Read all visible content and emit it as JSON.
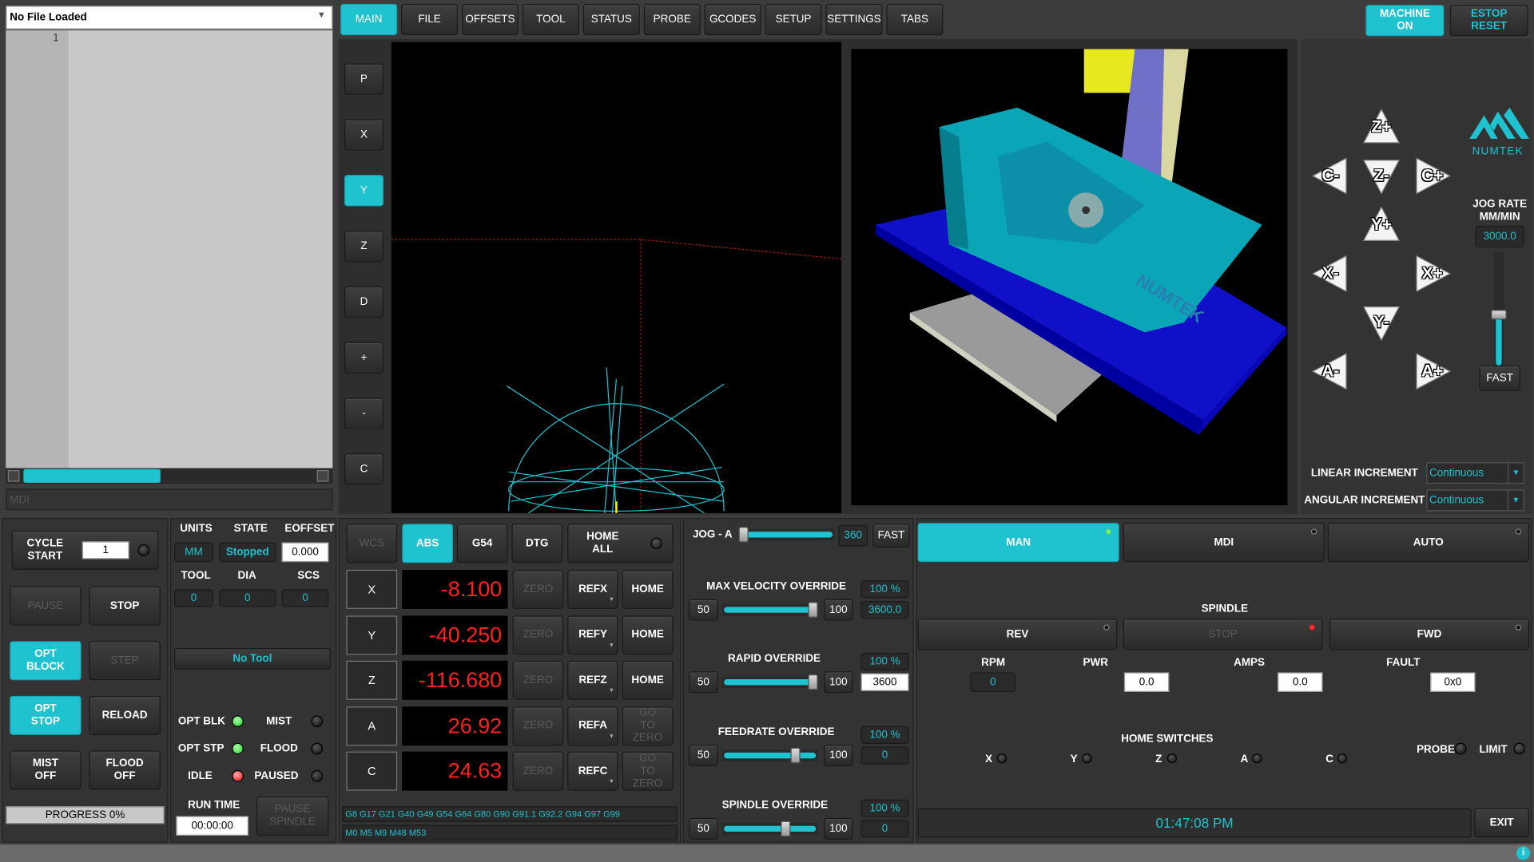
{
  "file": {
    "selector": "No File Loaded",
    "line_number": "1",
    "mdi_placeholder": "MDI"
  },
  "tabs": [
    "MAIN",
    "FILE",
    "OFFSETS",
    "TOOL",
    "STATUS",
    "PROBE",
    "GCODES",
    "SETUP",
    "SETTINGS",
    "TABS"
  ],
  "header": {
    "machine_on": "MACHINE ON",
    "estop_reset": "ESTOP RESET"
  },
  "view_buttons": [
    "P",
    "X",
    "Y",
    "Z",
    "D",
    "+",
    "-",
    "C"
  ],
  "jog": {
    "buttons": [
      "Z+",
      "C-",
      "Z-",
      "C+",
      "Y+",
      "X-",
      "X+",
      "Y-",
      "A-",
      "A+"
    ],
    "rate_label": "JOG RATE MM/MIN",
    "rate_value": "3000.0",
    "fast": "FAST",
    "linear_increment_label": "LINEAR INCREMENT",
    "linear_increment_value": "Continuous",
    "angular_increment_label": "ANGULAR INCREMENT",
    "angular_increment_value": "Continuous",
    "logo": "NUMTEK",
    "rate_fraction": 0.45
  },
  "cycle": {
    "cycle_start": "CYCLE START",
    "start_line": "1",
    "pause": "PAUSE",
    "stop": "STOP",
    "opt_block": "OPT BLOCK",
    "step": "STEP",
    "opt_stop": "OPT STOP",
    "reload": "RELOAD",
    "mist_off": "MIST OFF",
    "flood_off": "FLOOD OFF",
    "progress": "PROGRESS 0%"
  },
  "status": {
    "units_label": "UNITS",
    "state_label": "STATE",
    "eoffset_label": "EOFFSET",
    "units": "MM",
    "state": "Stopped",
    "eoffset": "0.000",
    "tool_label": "TOOL",
    "dia_label": "DIA",
    "scs_label": "SCS",
    "tool": "0",
    "dia": "0",
    "scs": "0",
    "tool_name": "No Tool",
    "opt_blk": "OPT BLK",
    "mist": "MIST",
    "opt_stp": "OPT STP",
    "flood": "FLOOD",
    "idle": "IDLE",
    "paused": "PAUSED",
    "run_time_label": "RUN TIME",
    "run_time": "00:00:00",
    "pause_spindle": "PAUSE SPINDLE"
  },
  "dro": {
    "wcs": "WCS",
    "abs": "ABS",
    "g54": "G54",
    "dtg": "DTG",
    "home_all": "HOME ALL",
    "axes": [
      {
        "name": "X",
        "value": "-8.100",
        "ref": "REFX",
        "act": "HOME"
      },
      {
        "name": "Y",
        "value": "-40.250",
        "ref": "REFY",
        "act": "HOME"
      },
      {
        "name": "Z",
        "value": "-116.680",
        "ref": "REFZ",
        "act": "HOME"
      },
      {
        "name": "A",
        "value": "26.92",
        "ref": "REFA",
        "act": "GO TO ZERO"
      },
      {
        "name": "C",
        "value": "24.63",
        "ref": "REFC",
        "act": "GO TO ZERO"
      }
    ],
    "zero": "ZERO",
    "gcodes": "G8 G17 G21 G40 G49 G54 G64 G80 G90 G91.1 G92.2 G94 G97 G99",
    "mcodes": "M0 M5 M9 M48 M53"
  },
  "overrides": {
    "jog_a_label": "JOG - A",
    "jog_a_value": "360",
    "fast": "FAST",
    "items": [
      {
        "label": "MAX VELOCITY OVERRIDE",
        "min": "50",
        "max": "100",
        "pct": "100 %",
        "val": "3600.0",
        "pos": 1.0
      },
      {
        "label": "RAPID OVERRIDE",
        "min": "50",
        "max": "100",
        "pct": "100 %",
        "val": "3600",
        "pos": 1.0
      },
      {
        "label": "FEEDRATE OVERRIDE",
        "min": "50",
        "max": "100",
        "pct": "100 %",
        "val": "0",
        "pos": 0.8
      },
      {
        "label": "SPINDLE OVERRIDE",
        "min": "50",
        "max": "100",
        "pct": "100 %",
        "val": "0",
        "pos": 0.68
      }
    ]
  },
  "mode": {
    "man": "MAN",
    "mdi": "MDI",
    "auto": "AUTO"
  },
  "spindle": {
    "label": "SPINDLE",
    "rev": "REV",
    "stop": "STOP",
    "fwd": "FWD",
    "rpm_label": "RPM",
    "pwr_label": "PWR",
    "amps_label": "AMPS",
    "fault_label": "FAULT",
    "rpm": "0",
    "pwr": "0.0",
    "amps": "0.0",
    "fault": "0x0"
  },
  "home_switches": {
    "label": "HOME SWITCHES",
    "axes": [
      "X",
      "Y",
      "Z",
      "A",
      "C"
    ],
    "probe": "PROBE",
    "limit": "LIMIT"
  },
  "footer": {
    "clock": "01:47:08 PM",
    "exit": "EXIT"
  },
  "colors": {
    "accent": "#1fc3d0",
    "dro_text": "#ff2020",
    "background": "#3c3c3c"
  }
}
